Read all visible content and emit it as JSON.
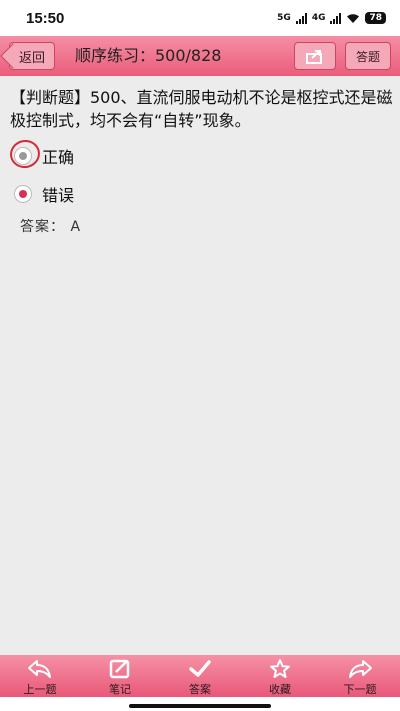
{
  "status": {
    "time": "15:50",
    "net1": "5G",
    "net2": "4G",
    "battery": "78"
  },
  "header": {
    "back_label": "返回",
    "title": "顺序练习：500/828",
    "answer_label": "答题"
  },
  "question": {
    "text": "【判断题】500、直流伺服电动机不论是枢控式还是磁极控制式，均不会有“自转”现象。"
  },
  "options": [
    {
      "label": "正确",
      "selected": false
    },
    {
      "label": "错误",
      "selected": true
    }
  ],
  "answer": {
    "text": "答案：  A"
  },
  "toolbar": {
    "items": [
      {
        "label": "上一题",
        "icon": "prev-arrow-icon"
      },
      {
        "label": "笔记",
        "icon": "note-edit-icon"
      },
      {
        "label": "答案",
        "icon": "checkmark-icon"
      },
      {
        "label": "收藏",
        "icon": "star-icon"
      },
      {
        "label": "下一题",
        "icon": "next-arrow-icon"
      }
    ]
  },
  "colors": {
    "accent": "#ea5d7b",
    "selected": "#d83050"
  }
}
